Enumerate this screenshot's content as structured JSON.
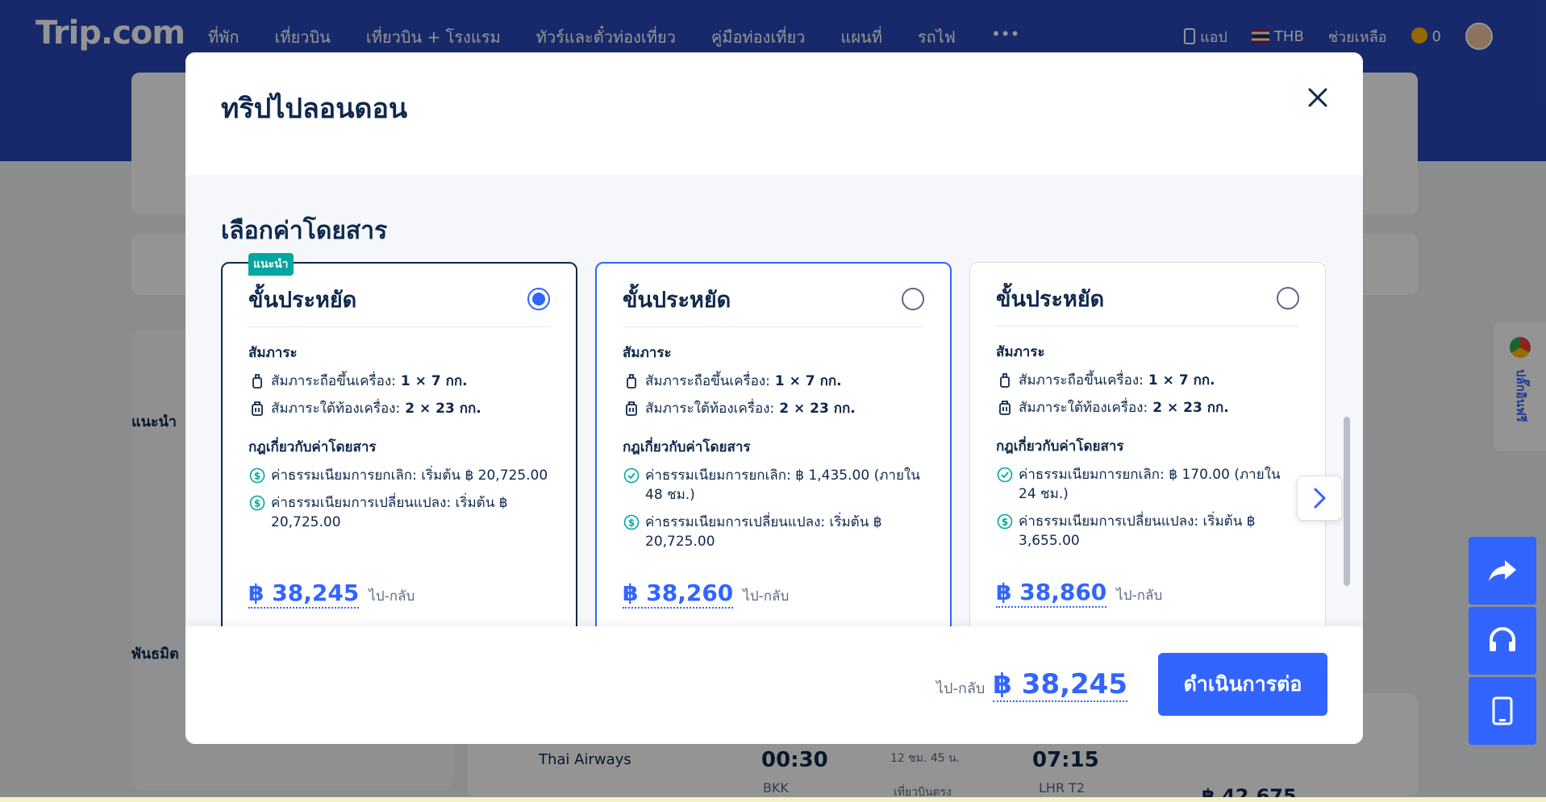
{
  "header": {
    "logo_main": "Trip",
    "logo_dot": ".com",
    "nav": [
      "ที่พัก",
      "เที่ยวบิน",
      "เที่ยวบิน + โรงแรม",
      "ทัวร์และตั๋วท่องเที่ยว",
      "คู่มือท่องเที่ยว",
      "แผนที่",
      "รถไฟ",
      "•••"
    ],
    "app_label": "แอป",
    "currency": "THB",
    "help": "ช่วยเหลือ",
    "coins": "0"
  },
  "background": {
    "filter_recommended": "แนะนำ",
    "filter_partners": "พันธมิต",
    "flight_airline": "Thai Airways",
    "flight_depart_time": "00:30",
    "flight_depart_airport": "BKK",
    "flight_duration": "12 ชม. 45 น.",
    "flight_type": "เที่ยวบินตรง",
    "flight_arrive_time": "07:15",
    "flight_arrive_airport": "LHR T2",
    "flight_price_partial": "฿ 42,675",
    "side_label": "ปลั๊กอินฟรี"
  },
  "modal": {
    "title": "ทริปไปลอนดอน",
    "section_title": "เลือกค่าโดยสาร",
    "cards": [
      {
        "badge": "แนะนำ",
        "class_name": "ขั้นประหยัด",
        "selected": true,
        "baggage_title": "สัมภาระ",
        "carry_on_label": "สัมภาระถือขึ้นเครื่อง:",
        "carry_on_value": "1 × 7 กก.",
        "checked_label": "สัมภาระใต้ท้องเครื่อง:",
        "checked_value": "2 × 23 กก.",
        "rules_title": "กฎเกี่ยวกับค่าโดยสาร",
        "cancel_fee": "ค่าธรรมเนียมการยกเลิก: เริ่มต้น ฿ 20,725.00",
        "change_fee": "ค่าธรรมเนียมการเปลี่ยนแปลง: เริ่มต้น ฿ 20,725.00",
        "price": "฿ 38,245",
        "price_sub": "ไป-กลับ"
      },
      {
        "badge": "",
        "class_name": "ขั้นประหยัด",
        "selected": false,
        "baggage_title": "สัมภาระ",
        "carry_on_label": "สัมภาระถือขึ้นเครื่อง:",
        "carry_on_value": "1 × 7 กก.",
        "checked_label": "สัมภาระใต้ท้องเครื่อง:",
        "checked_value": "2 × 23 กก.",
        "rules_title": "กฎเกี่ยวกับค่าโดยสาร",
        "cancel_fee": "ค่าธรรมเนียมการยกเลิก: ฿ 1,435.00 (ภายใน 48 ชม.)",
        "change_fee": "ค่าธรรมเนียมการเปลี่ยนแปลง: เริ่มต้น ฿ 20,725.00",
        "price": "฿ 38,260",
        "price_sub": "ไป-กลับ"
      },
      {
        "badge": "",
        "class_name": "ขั้นประหยัด",
        "selected": false,
        "baggage_title": "สัมภาระ",
        "carry_on_label": "สัมภาระถือขึ้นเครื่อง:",
        "carry_on_value": "1 × 7 กก.",
        "checked_label": "สัมภาระใต้ท้องเครื่อง:",
        "checked_value": "2 × 23 กก.",
        "rules_title": "กฎเกี่ยวกับค่าโดยสาร",
        "cancel_fee": "ค่าธรรมเนียมการยกเลิก: ฿ 170.00 (ภายใน 24 ชม.)",
        "change_fee": "ค่าธรรมเนียมการเปลี่ยนแปลง: เริ่มต้น ฿ 3,655.00",
        "price": "฿ 38,860",
        "price_sub": "ไป-กลับ"
      }
    ],
    "footer": {
      "total_sub": "ไป-กลับ",
      "total_price": "฿ 38,245",
      "continue_label": "ดำเนินการต่อ"
    }
  },
  "colors": {
    "brand": "#2948b8",
    "accent": "#3264ff",
    "text": "#0f294d",
    "badge": "#00a7a2"
  }
}
